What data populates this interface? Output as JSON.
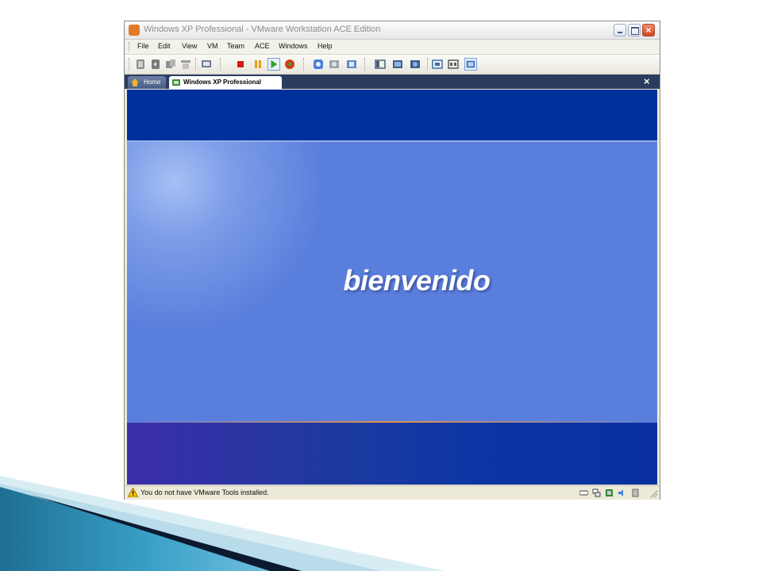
{
  "window": {
    "title": "Windows XP Professional - VMware Workstation ACE Edition",
    "controls": [
      "minimize",
      "maximize",
      "close"
    ]
  },
  "menu": [
    "File",
    "Edit",
    "View",
    "VM",
    "Team",
    "ACE",
    "Windows",
    "Help"
  ],
  "toolbar": {
    "icons": [
      "snapshot-icon",
      "revert-snapshot-icon",
      "snapshot-manager-icon",
      "team-icon",
      "vm-settings-icon",
      "stop-icon",
      "pause-icon",
      "play-icon",
      "reset-icon",
      "record-icon",
      "capture-icon",
      "replay-icon",
      "quick-switch-icon",
      "full-screen-icon",
      "unity-icon",
      "console-view-icon",
      "summary-view-icon",
      "appliance-view-icon"
    ]
  },
  "tabs": {
    "home_label": "Home",
    "vm_label": "Windows XP Professional",
    "close_symbol": "×"
  },
  "screen": {
    "welcome_text": "bienvenido",
    "colors": {
      "top_band": "#00309c",
      "middle": "#5a7edc",
      "bottom_band": "#1d3aa0",
      "accent_line": "#e0904a"
    }
  },
  "status": {
    "message": "You do not have VMware Tools installed.",
    "device_icons": [
      "hard-disk-icon",
      "network-icon",
      "usb-icon",
      "sound-icon",
      "floppy-icon"
    ]
  },
  "colors": {
    "slide_deco_dark": "#0b1a2e",
    "slide_deco_teal": "#3aa0c8",
    "slide_deco_light": "#b8dcea"
  }
}
